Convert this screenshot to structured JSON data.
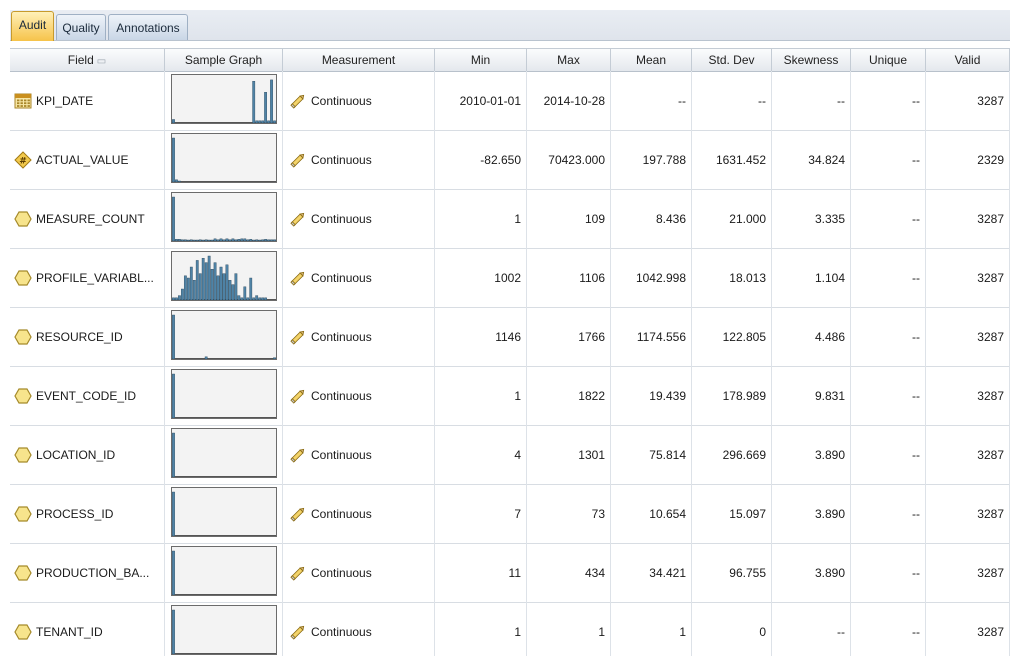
{
  "tabs": [
    {
      "label": "Audit",
      "active": true
    },
    {
      "label": "Quality",
      "active": false
    },
    {
      "label": "Annotations",
      "active": false
    }
  ],
  "columns": [
    "Field",
    "Sample Graph",
    "Measurement",
    "Min",
    "Max",
    "Mean",
    "Std. Dev",
    "Skewness",
    "Unique",
    "Valid"
  ],
  "colors": {
    "histogram_bar": "#4f83a6",
    "measurement_icon": "#d9a52b",
    "field_icon": "#e7c84f"
  },
  "rows": [
    {
      "field": "KPI_DATE",
      "icon": "calendar-table-icon",
      "measurement": "Continuous",
      "min": "2010-01-01",
      "max": "2014-10-28",
      "mean": "--",
      "std_dev": "--",
      "skewness": "--",
      "unique": "--",
      "valid": "3287",
      "histogram": [
        0.08,
        0,
        0,
        0,
        0,
        0,
        0,
        0,
        0,
        0,
        0,
        0,
        0,
        0,
        0,
        0,
        0,
        0,
        0,
        0,
        0,
        0,
        0,
        0,
        0,
        0,
        0,
        0.95,
        0.05,
        0.05,
        0.05,
        0.7,
        0.05,
        0.98,
        0.05
      ]
    },
    {
      "field": "ACTUAL_VALUE",
      "icon": "numeric-field-icon",
      "measurement": "Continuous",
      "min": "-82.650",
      "max": "70423.000",
      "mean": "197.788",
      "std_dev": "1631.452",
      "skewness": "34.824",
      "unique": "--",
      "valid": "2329",
      "histogram": [
        1.0,
        0.05,
        0.02,
        0,
        0,
        0,
        0,
        0,
        0,
        0,
        0,
        0,
        0,
        0,
        0,
        0,
        0,
        0,
        0,
        0,
        0,
        0,
        0,
        0,
        0,
        0,
        0,
        0,
        0,
        0,
        0,
        0,
        0,
        0,
        0
      ]
    },
    {
      "field": "MEASURE_COUNT",
      "icon": "continuous-field-icon",
      "measurement": "Continuous",
      "min": "1",
      "max": "109",
      "mean": "8.436",
      "std_dev": "21.000",
      "skewness": "3.335",
      "unique": "--",
      "valid": "3287",
      "histogram": [
        1.0,
        0.04,
        0.04,
        0.03,
        0.03,
        0.02,
        0.03,
        0.02,
        0.02,
        0.03,
        0.02,
        0.03,
        0.02,
        0.02,
        0.05,
        0.03,
        0.05,
        0.03,
        0.05,
        0.03,
        0.05,
        0.03,
        0.04,
        0.05,
        0.05,
        0.03,
        0.04,
        0.02,
        0.03,
        0.02,
        0.03,
        0.04,
        0.03,
        0.03,
        0.03
      ]
    },
    {
      "field": "PROFILE_VARIABL...",
      "icon": "continuous-field-icon",
      "measurement": "Continuous",
      "min": "1002",
      "max": "1106",
      "mean": "1042.998",
      "std_dev": "18.013",
      "skewness": "1.104",
      "unique": "--",
      "valid": "3287",
      "histogram": [
        0.05,
        0.05,
        0.1,
        0.25,
        0.55,
        0.5,
        0.75,
        0.45,
        0.9,
        0.6,
        0.95,
        0.85,
        1.0,
        0.7,
        0.85,
        0.55,
        0.75,
        0.6,
        0.8,
        0.45,
        0.35,
        0.6,
        0.1,
        0.05,
        0.3,
        0.05,
        0.5,
        0.05,
        0.1,
        0.05,
        0.05,
        0.05,
        0,
        0,
        0
      ]
    },
    {
      "field": "RESOURCE_ID",
      "icon": "continuous-field-icon",
      "measurement": "Continuous",
      "min": "1146",
      "max": "1766",
      "mean": "1174.556",
      "std_dev": "122.805",
      "skewness": "4.486",
      "unique": "--",
      "valid": "3287",
      "histogram": [
        1.0,
        0,
        0,
        0,
        0,
        0,
        0,
        0,
        0,
        0,
        0,
        0.05,
        0,
        0,
        0,
        0,
        0,
        0,
        0,
        0,
        0,
        0,
        0,
        0,
        0,
        0,
        0,
        0,
        0,
        0,
        0,
        0,
        0,
        0,
        0.03
      ]
    },
    {
      "field": "EVENT_CODE_ID",
      "icon": "continuous-field-icon",
      "measurement": "Continuous",
      "min": "1",
      "max": "1822",
      "mean": "19.439",
      "std_dev": "178.989",
      "skewness": "9.831",
      "unique": "--",
      "valid": "3287",
      "histogram": [
        1.0,
        0,
        0,
        0,
        0,
        0,
        0,
        0,
        0,
        0,
        0,
        0,
        0,
        0,
        0,
        0,
        0,
        0,
        0,
        0,
        0,
        0,
        0,
        0,
        0,
        0,
        0,
        0,
        0,
        0,
        0,
        0,
        0,
        0,
        0
      ]
    },
    {
      "field": "LOCATION_ID",
      "icon": "continuous-field-icon",
      "measurement": "Continuous",
      "min": "4",
      "max": "1301",
      "mean": "75.814",
      "std_dev": "296.669",
      "skewness": "3.890",
      "unique": "--",
      "valid": "3287",
      "histogram": [
        1.0,
        0,
        0,
        0,
        0,
        0,
        0,
        0,
        0,
        0,
        0,
        0,
        0,
        0,
        0,
        0,
        0,
        0,
        0,
        0,
        0,
        0,
        0,
        0,
        0,
        0,
        0,
        0,
        0,
        0,
        0,
        0,
        0,
        0,
        0
      ]
    },
    {
      "field": "PROCESS_ID",
      "icon": "continuous-field-icon",
      "measurement": "Continuous",
      "min": "7",
      "max": "73",
      "mean": "10.654",
      "std_dev": "15.097",
      "skewness": "3.890",
      "unique": "--",
      "valid": "3287",
      "histogram": [
        1.0,
        0,
        0,
        0,
        0,
        0,
        0,
        0,
        0,
        0,
        0,
        0,
        0,
        0,
        0,
        0,
        0,
        0,
        0,
        0,
        0,
        0,
        0,
        0,
        0,
        0,
        0,
        0,
        0,
        0,
        0,
        0,
        0,
        0,
        0
      ]
    },
    {
      "field": "PRODUCTION_BA...",
      "icon": "continuous-field-icon",
      "measurement": "Continuous",
      "min": "11",
      "max": "434",
      "mean": "34.421",
      "std_dev": "96.755",
      "skewness": "3.890",
      "unique": "--",
      "valid": "3287",
      "histogram": [
        1.0,
        0,
        0,
        0,
        0,
        0,
        0,
        0,
        0,
        0,
        0,
        0,
        0,
        0,
        0,
        0,
        0,
        0,
        0,
        0,
        0,
        0,
        0,
        0,
        0,
        0,
        0,
        0,
        0,
        0,
        0,
        0,
        0,
        0,
        0
      ]
    },
    {
      "field": "TENANT_ID",
      "icon": "continuous-field-icon",
      "measurement": "Continuous",
      "min": "1",
      "max": "1",
      "mean": "1",
      "std_dev": "0",
      "skewness": "--",
      "unique": "--",
      "valid": "3287",
      "histogram": [
        1.0,
        0,
        0,
        0,
        0,
        0,
        0,
        0,
        0,
        0,
        0,
        0,
        0,
        0,
        0,
        0,
        0,
        0,
        0,
        0,
        0,
        0,
        0,
        0,
        0,
        0,
        0,
        0,
        0,
        0,
        0,
        0,
        0,
        0,
        0
      ]
    }
  ]
}
